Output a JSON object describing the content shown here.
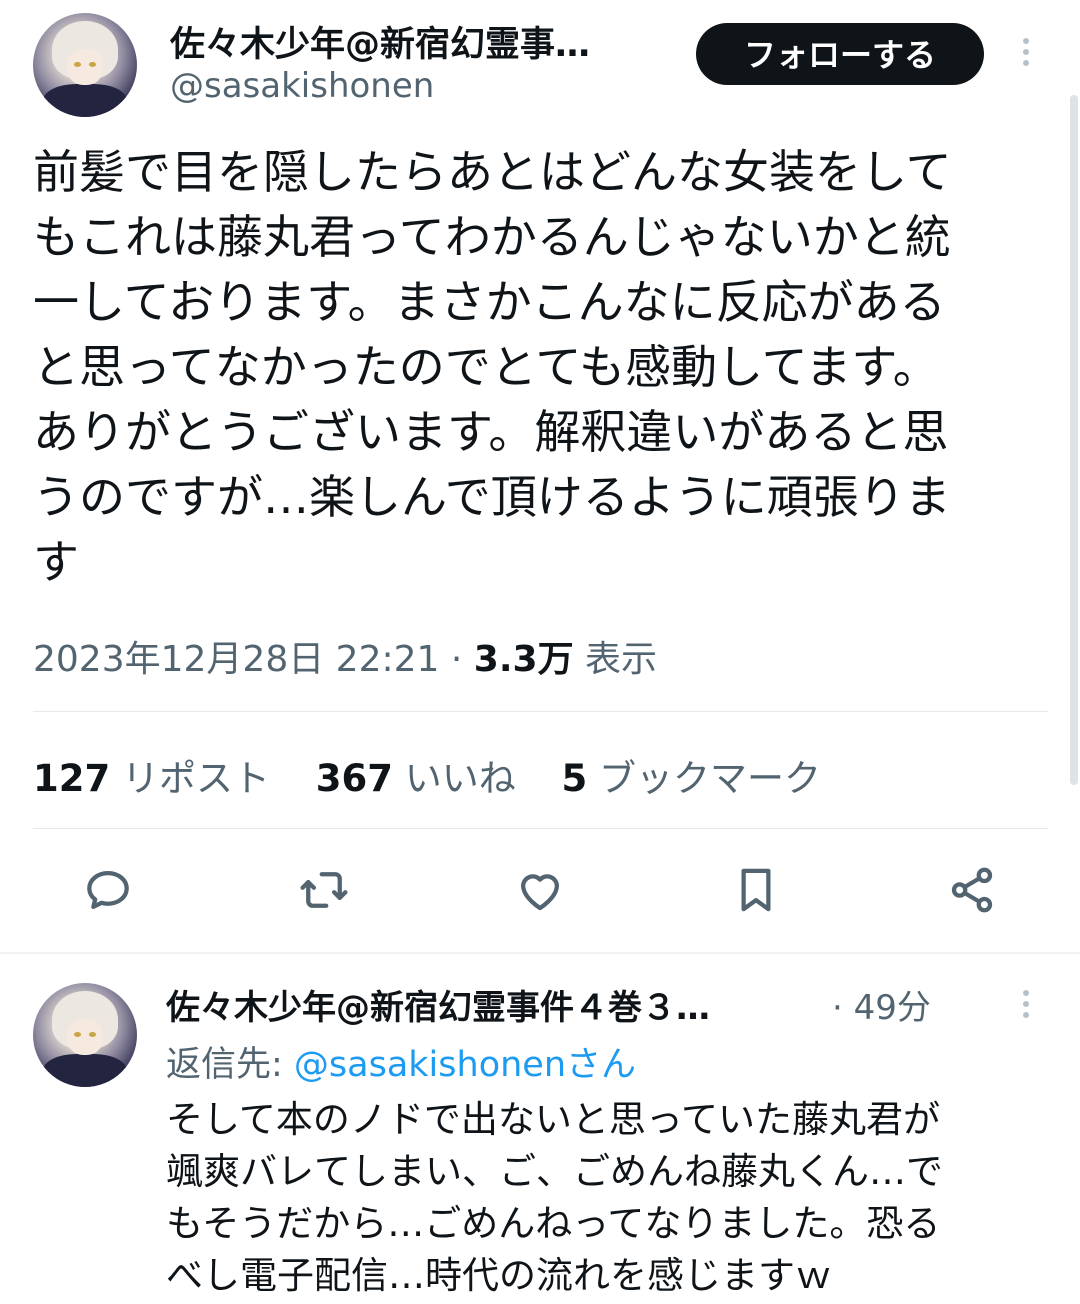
{
  "tweet": {
    "author": {
      "display_name": "佐々木少年@新宿幻霊事…",
      "handle": "@sasakishonen"
    },
    "follow_label": "フォローする",
    "text": "前髪で目を隠したらあとはどんな女装をして\nもこれは藤丸君ってわかるんじゃないかと統\n一しております。まさかこんなに反応がある\nと思ってなかったのでとても感動してます。\nありがとうございます。解釈違いがあると思\nうのですが…楽しんで頂けるように頑張りま\nす",
    "datetime": "2023年12月28日 22:21",
    "separator": "·",
    "views_count": "3.3万",
    "views_label": "表示",
    "stats": {
      "reposts_count": "127",
      "reposts_label": "リポスト",
      "likes_count": "367",
      "likes_label": "いいね",
      "bookmarks_count": "5",
      "bookmarks_label": "ブックマーク"
    },
    "actions": [
      "reply-icon",
      "repost-icon",
      "like-icon",
      "bookmark-icon",
      "share-icon"
    ]
  },
  "reply": {
    "display_name": "佐々木少年@新宿幻霊事件４巻３…",
    "time": "· 49分",
    "reply_to_label": "返信先: ",
    "reply_to_mention": "@sasakishonenさん",
    "text": "そして本のノドで出ないと思っていた藤丸君が\n颯爽バレてしまい、ご、ごめんね藤丸くん…で\nもそうだから…ごめんねってなりました。恐る\nべし電子配信…時代の流れを感じますｗ"
  },
  "colors": {
    "text_primary": "#0f1419",
    "text_secondary": "#536471",
    "accent": "#1d9bf0",
    "follow_bg": "#0f1419",
    "divider": "#e6eaed"
  }
}
